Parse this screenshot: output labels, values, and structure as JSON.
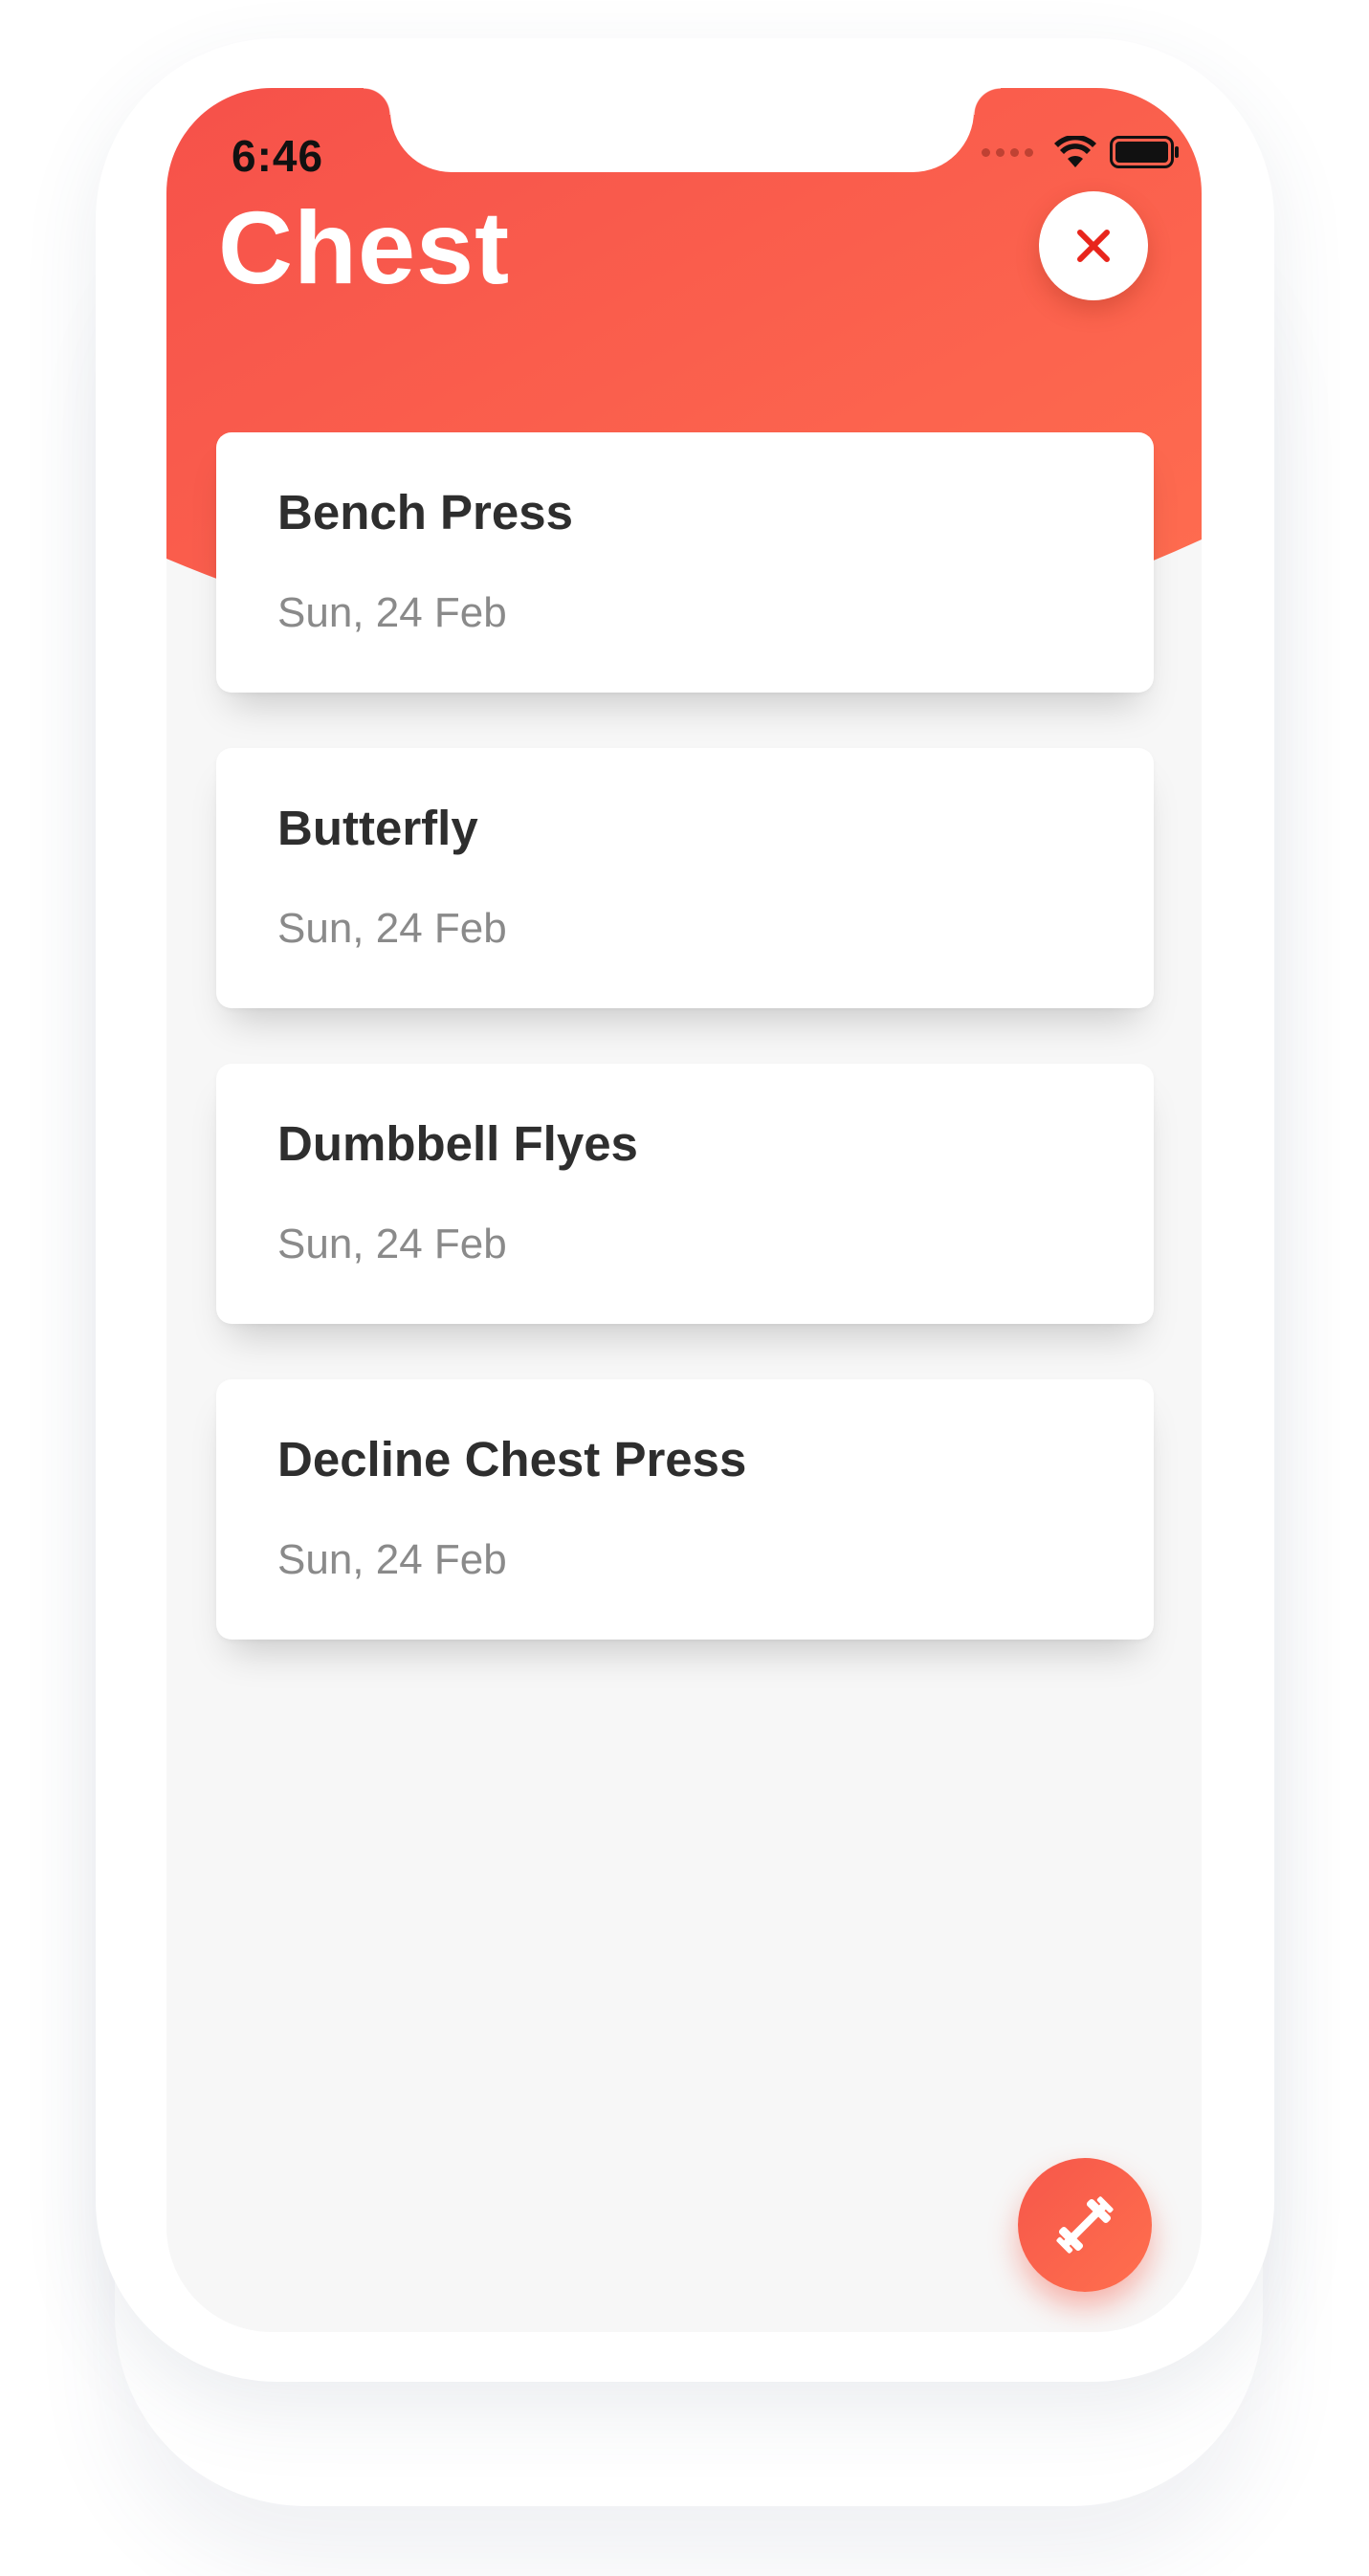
{
  "status_bar": {
    "time": "6:46"
  },
  "header": {
    "title": "Chest",
    "close_icon": "close-icon",
    "gradient_start": "#f6514a",
    "gradient_end": "#ff6e50"
  },
  "exercises": [
    {
      "name": "Bench Press",
      "date": "Sun, 24 Feb"
    },
    {
      "name": "Butterfly",
      "date": "Sun, 24 Feb"
    },
    {
      "name": "Dumbbell Flyes",
      "date": "Sun, 24 Feb"
    },
    {
      "name": "Decline Chest Press",
      "date": "Sun, 24 Feb"
    }
  ],
  "fab": {
    "icon": "dumbbell-icon"
  },
  "colors": {
    "accent": "#f6574a",
    "close_x": "#e8251c",
    "background": "#f7f7f7",
    "card": "#ffffff"
  }
}
